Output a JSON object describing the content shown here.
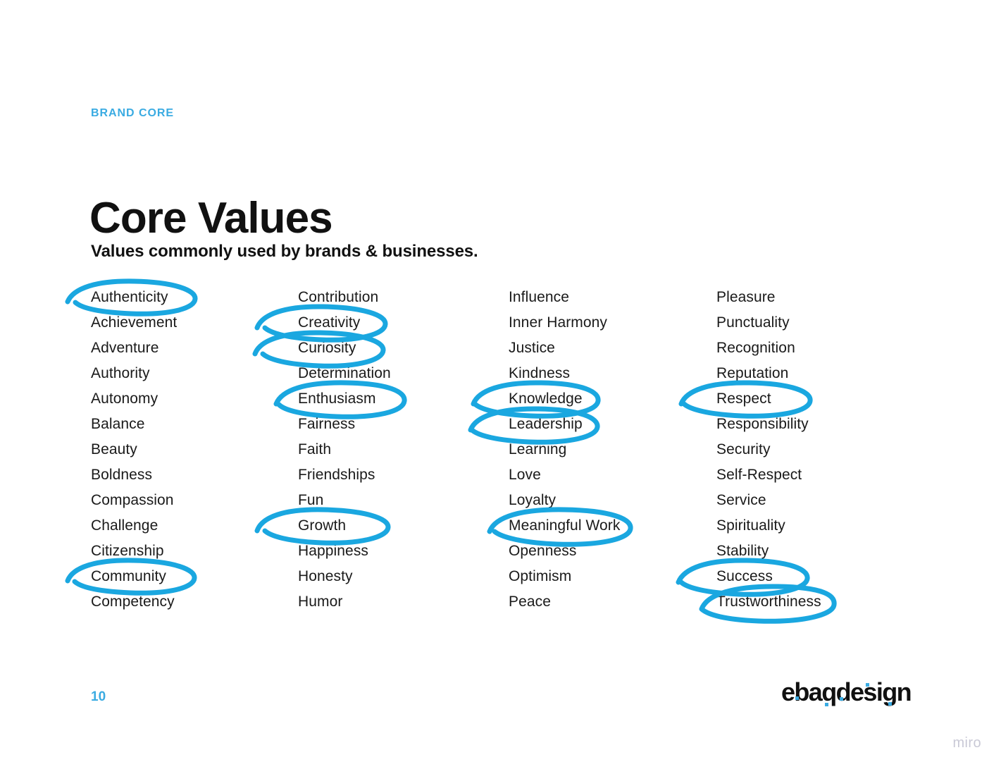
{
  "header": {
    "eyebrow": "BRAND CORE",
    "title": "Core Values",
    "subtitle": "Values commonly used by brands & businesses."
  },
  "colors": {
    "accent_blue": "#3aabe2",
    "annotation_blue": "#1aa7e0",
    "text_black": "#1a1a1a",
    "watermark_gray": "#c9c9d6",
    "background": "#ffffff"
  },
  "values": {
    "columns": [
      {
        "items": [
          "Authenticity",
          "Achievement",
          "Adventure",
          "Authority",
          "Autonomy",
          "Balance",
          "Beauty",
          "Boldness",
          "Compassion",
          "Challenge",
          "Citizenship",
          "Community",
          "Competency"
        ]
      },
      {
        "items": [
          "Contribution",
          "Creativity",
          "Curiosity",
          "Determination",
          "Enthusiasm",
          "Fairness",
          "Faith",
          "Friendships",
          "Fun",
          "Growth",
          "Happiness",
          "Honesty",
          "Humor"
        ]
      },
      {
        "items": [
          "Influence",
          "Inner Harmony",
          "Justice",
          "Kindness",
          "Knowledge",
          "Leadership",
          "Learning",
          "Love",
          "Loyalty",
          "Meaningful Work",
          "Openness",
          "Optimism",
          "Peace"
        ]
      },
      {
        "items": [
          "Pleasure",
          "Punctuality",
          "Recognition",
          "Reputation",
          "Respect",
          "Responsibility",
          "Security",
          "Self-Respect",
          "Service",
          "Spirituality",
          "Stability",
          "Success",
          "Trustworthiness"
        ]
      }
    ]
  },
  "annotations": {
    "style": "hand-drawn-blue-ellipse",
    "circled_values": [
      "Authenticity",
      "Community",
      "Creativity",
      "Curiosity",
      "Enthusiasm",
      "Growth",
      "Knowledge",
      "Leadership",
      "Meaningful Work",
      "Respect",
      "Success",
      "Trustworthiness"
    ]
  },
  "footer": {
    "page_number": "10",
    "logo_text": "ebaqdesign",
    "watermark": "miro"
  }
}
